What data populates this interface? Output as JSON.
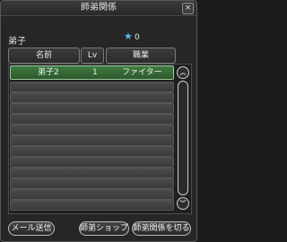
{
  "window": {
    "title": "師弟関係",
    "close_glyph": "×"
  },
  "disciple": {
    "label": "弟子",
    "star_count": "0"
  },
  "columns": [
    "名前",
    "Lv",
    "職業"
  ],
  "rows": [
    {
      "name": "弟子2",
      "lv": "1",
      "job": "ファイター",
      "selected": true
    }
  ],
  "empty_rows": 12,
  "scroll": {
    "up_glyph": "︽",
    "down_glyph": "︾"
  },
  "buttons": {
    "mail": "メール送信",
    "shop": "師弟ショップ",
    "cut": "師弟関係を切る"
  },
  "colors": {
    "selected_row": "#3f7a3f",
    "star": "#57b8f0"
  }
}
